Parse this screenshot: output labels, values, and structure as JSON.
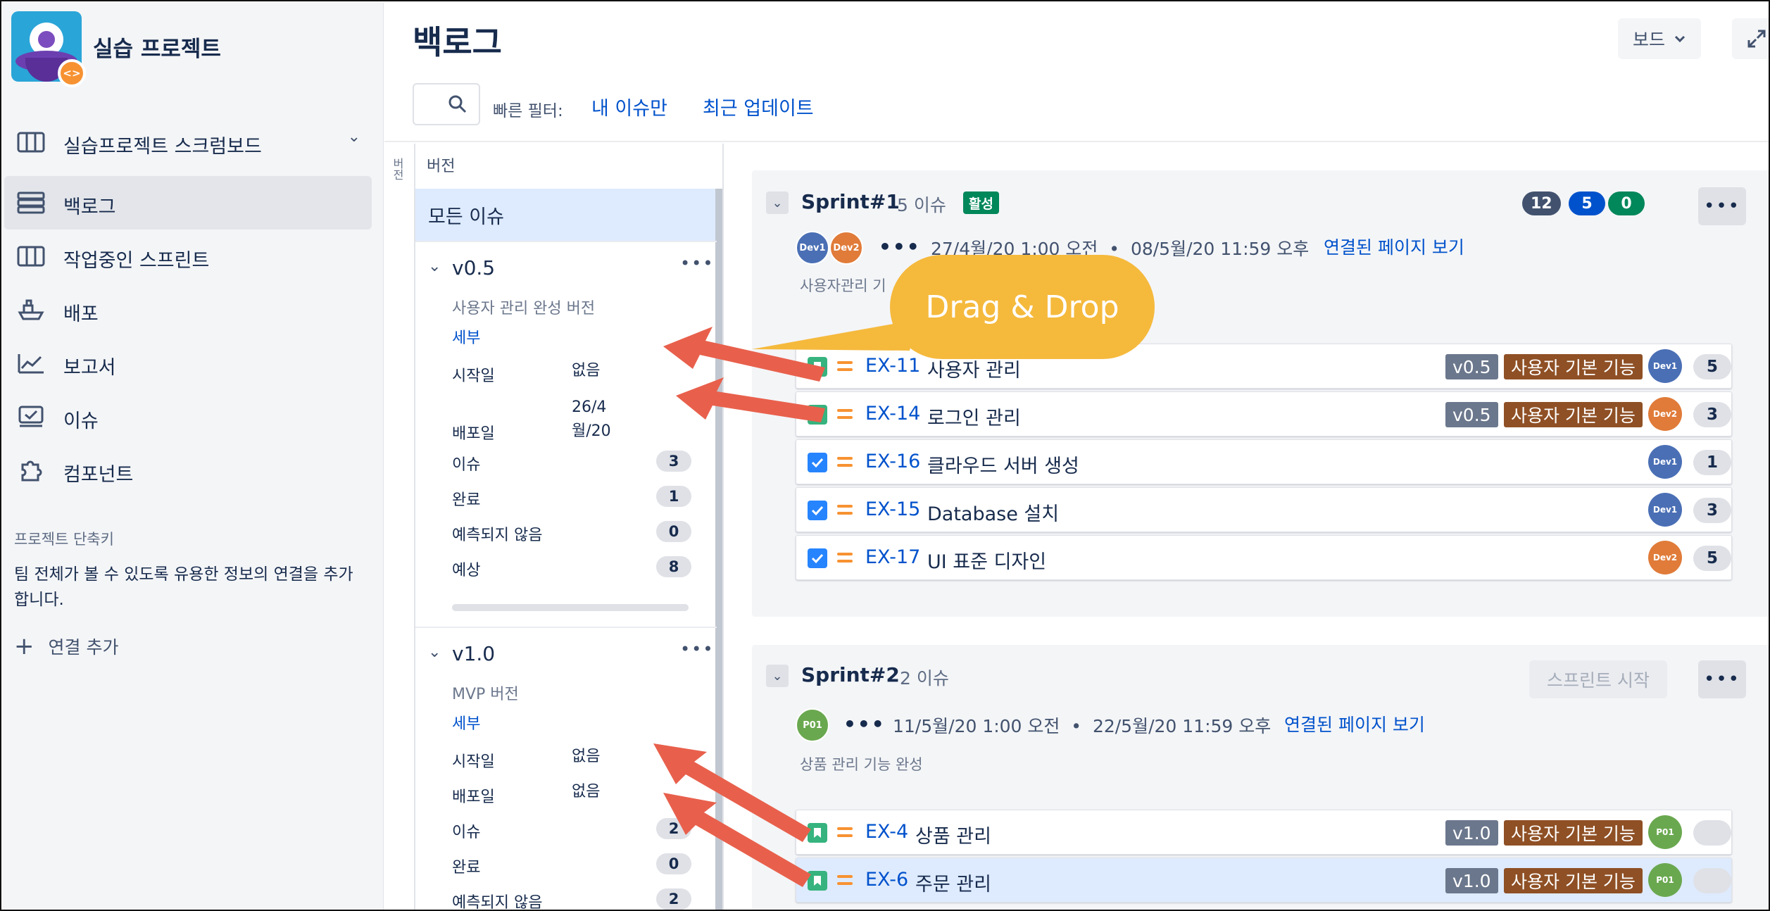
{
  "project": {
    "name": "실습 프로젝트",
    "badge_glyph": "<>"
  },
  "sidebar": {
    "items": [
      {
        "label": "실습프로젝트 스크럼보드",
        "icon": "board-icon"
      },
      {
        "label": "백로그",
        "icon": "backlog-icon"
      },
      {
        "label": "작업중인 스프린트",
        "icon": "sprint-icon"
      },
      {
        "label": "배포",
        "icon": "ship-icon"
      },
      {
        "label": "보고서",
        "icon": "chart-icon"
      },
      {
        "label": "이슈",
        "icon": "issues-icon"
      },
      {
        "label": "컴포넌트",
        "icon": "puzzle-icon"
      }
    ],
    "shortcut_title": "프로젝트 단축키",
    "shortcut_desc": "팀 전체가 볼 수 있도록 유용한 정보의 연결을 추가합니다.",
    "add_link": "연결 추가"
  },
  "header": {
    "title": "백로그",
    "board_button": "보드",
    "quick_filter_label": "빠른 필터:",
    "quick_filters": [
      "내 이슈만",
      "최근 업데이트"
    ]
  },
  "versions": {
    "tab_label": "버전",
    "panel_title": "버전",
    "all_issues": "모든 이슈",
    "list": [
      {
        "name": "v0.5",
        "desc": "사용자 관리 완성 버전",
        "detail": "세부",
        "start_label": "시작일",
        "start_value": "없음",
        "release_label": "배포일",
        "release_value": "26/4\n월/20",
        "issues_label": "이슈",
        "issues": "3",
        "done_label": "완료",
        "done": "1",
        "unestimated_label": "예측되지 않음",
        "unestimated": "0",
        "estimate_label": "예상",
        "estimate": "8"
      },
      {
        "name": "v1.0",
        "desc": "MVP 버전",
        "detail": "세부",
        "start_label": "시작일",
        "start_value": "없음",
        "release_label": "배포일",
        "release_value": "없음",
        "issues_label": "이슈",
        "issues": "2",
        "done_label": "완료",
        "done": "0",
        "unestimated_label": "예측되지 않음",
        "unestimated": "2"
      }
    ]
  },
  "sprints": [
    {
      "name": "Sprint#1",
      "count": "5 이슈",
      "status": "활성",
      "stat_todo": "12",
      "stat_progress": "5",
      "stat_done": "0",
      "assignees": [
        "Dev1",
        "Dev2"
      ],
      "dates": "27/4월/20 1:00 오전  •  08/5월/20 11:59 오후",
      "link": "연결된 페이지 보기",
      "goal": "사용자관리 기",
      "issues": [
        {
          "type": "story",
          "key": "EX-11",
          "title": "사용자 관리",
          "version": "v0.5",
          "epic": "사용자 기본 기능",
          "assignee": "Dev1",
          "estimate": "5"
        },
        {
          "type": "story",
          "key": "EX-14",
          "title": "로그인 관리",
          "version": "v0.5",
          "epic": "사용자 기본 기능",
          "assignee": "Dev2",
          "estimate": "3"
        },
        {
          "type": "task",
          "key": "EX-16",
          "title": "클라우드 서버 생성",
          "assignee": "Dev1",
          "estimate": "1"
        },
        {
          "type": "task",
          "key": "EX-15",
          "title": "Database 설치",
          "assignee": "Dev1",
          "estimate": "3"
        },
        {
          "type": "task",
          "key": "EX-17",
          "title": "UI 표준 디자인",
          "assignee": "Dev2",
          "estimate": "5"
        }
      ]
    },
    {
      "name": "Sprint#2",
      "count": "2 이슈",
      "start_button": "스프린트 시작",
      "assignees": [
        "P01"
      ],
      "dates": "11/5월/20 1:00 오전  •  22/5월/20 11:59 오후",
      "link": "연결된 페이지 보기",
      "goal": "상품 관리 기능 완성",
      "issues": [
        {
          "type": "story",
          "key": "EX-4",
          "title": "상품 관리",
          "version": "v1.0",
          "epic": "사용자 기본 기능",
          "assignee": "P01",
          "estimate": ""
        },
        {
          "type": "story",
          "key": "EX-6",
          "title": "주문 관리",
          "version": "v1.0",
          "epic": "사용자 기본 기능",
          "assignee": "P01",
          "estimate": ""
        }
      ]
    }
  ],
  "annotation": {
    "callout": "Drag & Drop"
  },
  "colors": {
    "link": "#0052cc",
    "active_green": "#00875a",
    "stat_gray": "#42526e",
    "stat_blue": "#0052cc",
    "epic_brown": "#8f5025",
    "dev1": "#4a6fb5",
    "dev2": "#e07b39",
    "p01": "#6aa84f",
    "callout": "#f5b93c",
    "arrow": "#e8604c"
  }
}
